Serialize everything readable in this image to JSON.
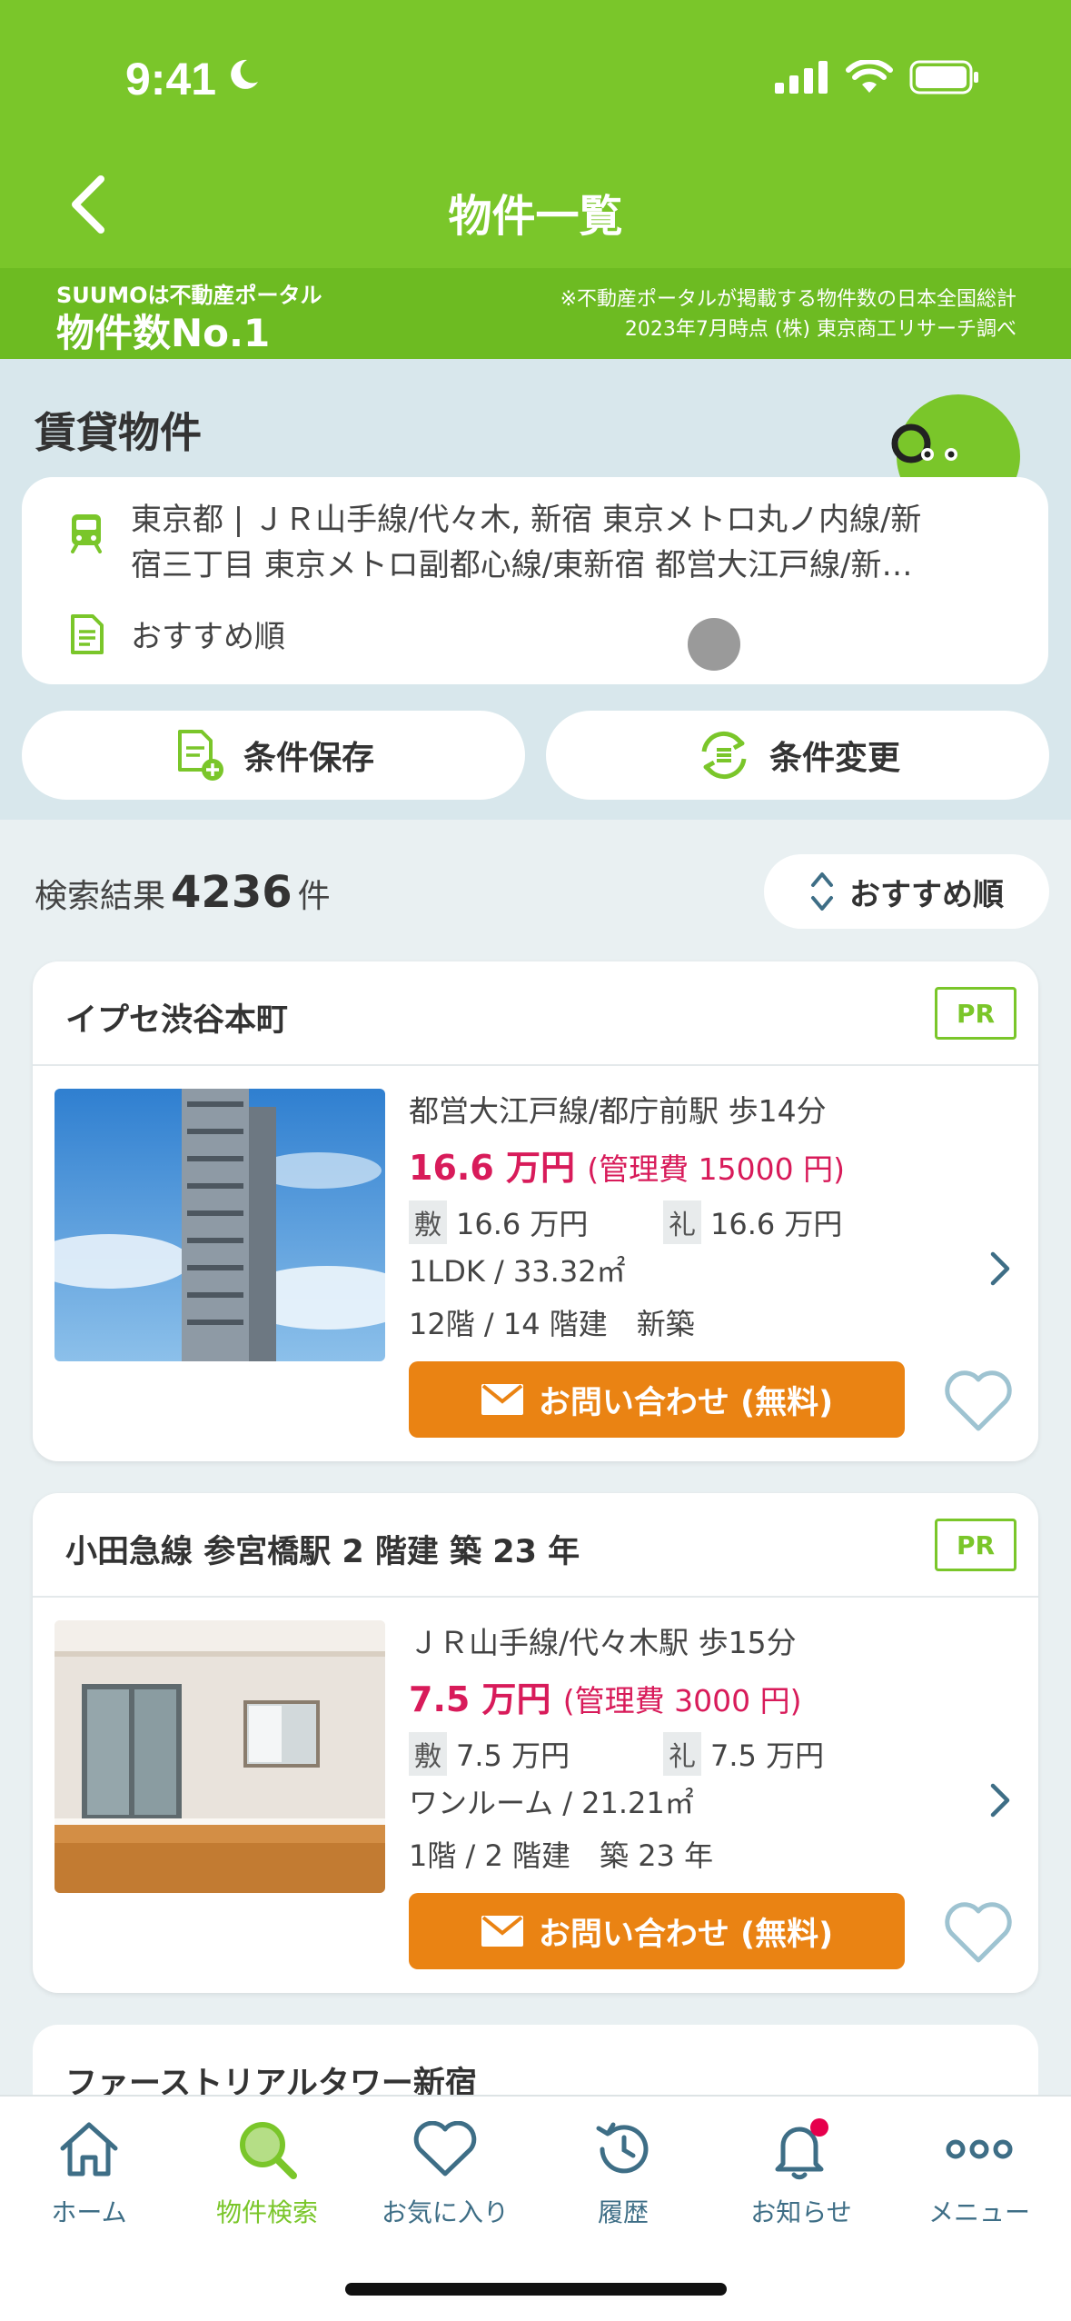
{
  "status": {
    "time": "9:41"
  },
  "nav": {
    "title": "物件一覧"
  },
  "banner": {
    "sub": "SUUMOは不動産ポータル",
    "main": "物件数No.1",
    "note_line1": "※不動産ポータルが掲載する物件数の日本全国総計",
    "note_line2": "2023年7月時点 (株) 東京商工リサーチ調べ"
  },
  "conditions": {
    "section_title": "賃貸物件",
    "route_line1": "東京都 | ＪＲ山手線/代々木,  新宿 東京メトロ丸ノ内線/新",
    "route_line2": "宿三丁目 東京メトロ副都心線/東新宿 都営大江戸線/新…",
    "sort": "おすすめ順",
    "save_label": "条件保存",
    "change_label": "条件変更"
  },
  "results": {
    "prefix": "検索結果",
    "count": "4236",
    "suffix": "件",
    "sort_label": "おすすめ順"
  },
  "listings": [
    {
      "title": "イプセ渋谷本町",
      "badge": "PR",
      "access": "都営大江戸線/都庁前駅 歩14分",
      "rent": "16.6 万円",
      "fee": "(管理費 15000 円)",
      "deposit_tag": "敷",
      "deposit": "16.6 万円",
      "key_tag": "礼",
      "key_money": "16.6 万円",
      "layout": "1LDK / 33.32㎡",
      "floor": "12階 / 14 階建　新築",
      "inquiry": "お問い合わせ (無料)"
    },
    {
      "title": "小田急線 参宮橋駅 2 階建 築 23 年",
      "badge": "PR",
      "access": "ＪＲ山手線/代々木駅 歩15分",
      "rent": "7.5 万円",
      "fee": "(管理費 3000 円)",
      "deposit_tag": "敷",
      "deposit": "7.5 万円",
      "key_tag": "礼",
      "key_money": "7.5 万円",
      "layout": "ワンルーム / 21.21㎡",
      "floor": "1階 / 2 階建　築 23 年",
      "inquiry": "お問い合わせ (無料)"
    },
    {
      "title": "ファーストリアルタワー新宿"
    }
  ],
  "tabs": [
    {
      "label": "ホーム",
      "icon": "home-icon"
    },
    {
      "label": "物件検索",
      "icon": "search-icon"
    },
    {
      "label": "お気に入り",
      "icon": "heart-icon"
    },
    {
      "label": "履歴",
      "icon": "history-icon"
    },
    {
      "label": "お知らせ",
      "icon": "bell-icon"
    },
    {
      "label": "メニュー",
      "icon": "more-icon"
    }
  ],
  "colors": {
    "brand_green": "#7ac62a",
    "rent_pink": "#d81b5a",
    "inquiry_orange": "#ea8313",
    "tab_blue": "#3e6e86"
  }
}
